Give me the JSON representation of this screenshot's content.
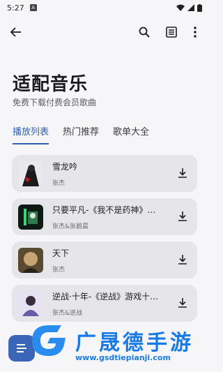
{
  "status_bar": {
    "time": "5:27",
    "notif_glyph": "A"
  },
  "toolbar": {
    "back_icon": "back-arrow-icon",
    "search_icon": "search-icon",
    "list_icon": "playlist-icon",
    "more_icon": "more-vert-icon"
  },
  "header": {
    "title": "适配音乐",
    "subtitle": "免费下载付费会员歌曲"
  },
  "tabs": [
    {
      "label": "播放列表",
      "active": true
    },
    {
      "label": "热门推荐",
      "active": false
    },
    {
      "label": "歌单大全",
      "active": false
    }
  ],
  "songs": [
    {
      "title": "雪龙吟",
      "artist": "张杰"
    },
    {
      "title": "只要平凡-《我不是药神》电影主题曲",
      "artist": "张杰&张碧晨"
    },
    {
      "title": "天下",
      "artist": "张杰"
    },
    {
      "title": "逆战·十年-《逆战》游戏十周年主题曲",
      "artist": "张杰&逆战"
    }
  ],
  "fab": {
    "icon": "menu-lines-icon"
  },
  "watermark": {
    "title": "广晟德手游",
    "url": "www.gsdtiepianji.com"
  },
  "colors": {
    "accent": "#2f5fb3",
    "card": "#e6e6ea",
    "background": "#f6f6f8",
    "watermark": "#1a7be6"
  }
}
